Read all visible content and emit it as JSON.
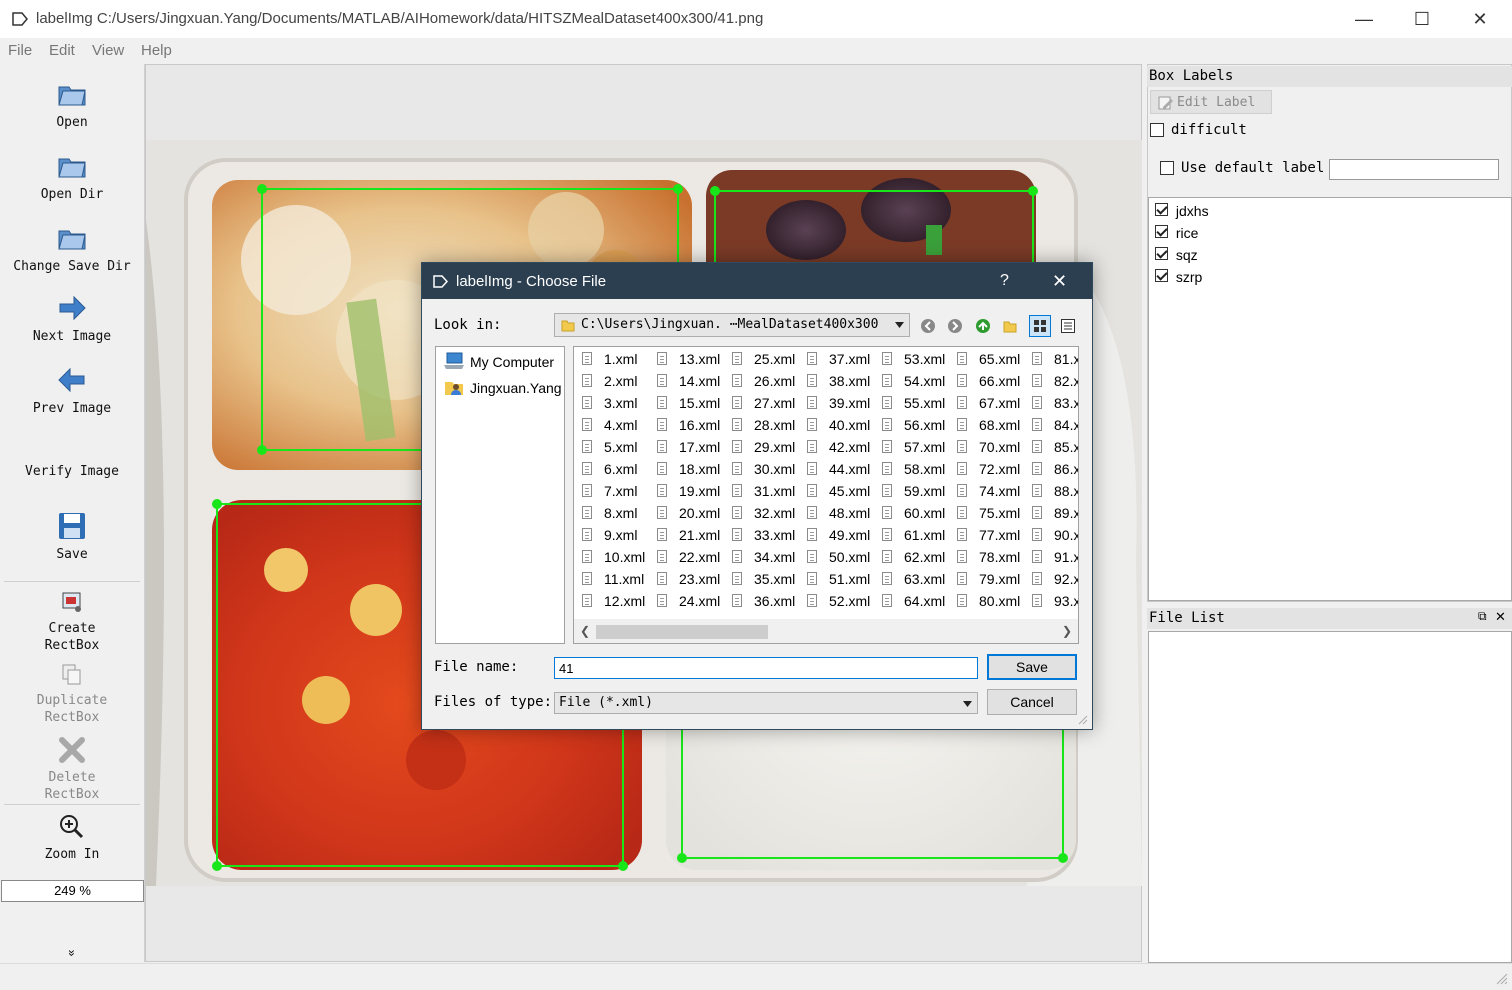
{
  "window": {
    "title": "labelImg C:/Users/Jingxuan.Yang/Documents/MATLAB/AIHomework/data/HITSZMealDataset400x300/41.png",
    "minimize_glyph": "—",
    "maximize_glyph": "☐",
    "close_glyph": "✕"
  },
  "menu": [
    "File",
    "Edit",
    "View",
    "Help"
  ],
  "toolbar": {
    "open": "Open",
    "open_dir": "Open Dir",
    "change_save_dir": "Change Save Dir",
    "next_image": "Next Image",
    "prev_image": "Prev Image",
    "verify_image": "Verify Image",
    "save": "Save",
    "create_rectbox_1": "Create",
    "create_rectbox_2": "RectBox",
    "duplicate_rectbox_1": "Duplicate",
    "duplicate_rectbox_2": "RectBox",
    "delete_rectbox_1": "Delete",
    "delete_rectbox_2": "RectBox",
    "zoom_in": "Zoom In",
    "zoom_value": "249 %",
    "more_glyph": "»"
  },
  "box_labels_panel": {
    "title": "Box Labels",
    "edit_label": "Edit Label",
    "difficult": "difficult",
    "use_default_label": "Use default label",
    "default_label_value": "",
    "labels": [
      {
        "name": "jdxhs",
        "checked": true
      },
      {
        "name": "rice",
        "checked": true
      },
      {
        "name": "sqz",
        "checked": true
      },
      {
        "name": "szrp",
        "checked": true
      }
    ]
  },
  "file_list_panel": {
    "title": "File List",
    "float_glyph": "⧉",
    "close_glyph": "✕"
  },
  "dialog": {
    "title": "labelImg - Choose File",
    "help_glyph": "?",
    "close_glyph": "✕",
    "look_in_label": "Look in:",
    "look_in_path": "C:\\Users\\Jingxuan.  ⋯MealDataset400x300",
    "places": [
      "My Computer",
      "Jingxuan.Yang"
    ],
    "files": [
      [
        "1.xml",
        "2.xml",
        "3.xml",
        "4.xml",
        "5.xml",
        "6.xml",
        "7.xml",
        "8.xml",
        "9.xml",
        "10.xml",
        "11.xml",
        "12.xml"
      ],
      [
        "13.xml",
        "14.xml",
        "15.xml",
        "16.xml",
        "17.xml",
        "18.xml",
        "19.xml",
        "20.xml",
        "21.xml",
        "22.xml",
        "23.xml",
        "24.xml"
      ],
      [
        "25.xml",
        "26.xml",
        "27.xml",
        "28.xml",
        "29.xml",
        "30.xml",
        "31.xml",
        "32.xml",
        "33.xml",
        "34.xml",
        "35.xml",
        "36.xml"
      ],
      [
        "37.xml",
        "38.xml",
        "39.xml",
        "40.xml",
        "42.xml",
        "44.xml",
        "45.xml",
        "48.xml",
        "49.xml",
        "50.xml",
        "51.xml",
        "52.xml"
      ],
      [
        "53.xml",
        "54.xml",
        "55.xml",
        "56.xml",
        "57.xml",
        "58.xml",
        "59.xml",
        "60.xml",
        "61.xml",
        "62.xml",
        "63.xml",
        "64.xml"
      ],
      [
        "65.xml",
        "66.xml",
        "67.xml",
        "68.xml",
        "70.xml",
        "72.xml",
        "74.xml",
        "75.xml",
        "77.xml",
        "78.xml",
        "79.xml",
        "80.xml"
      ],
      [
        "81.x",
        "82.x",
        "83.x",
        "84.x",
        "85.x",
        "86.x",
        "88.x",
        "89.x",
        "90.x",
        "91.x",
        "92.x",
        "93.x"
      ]
    ],
    "file_name_label": "File name:",
    "file_name_value": "41",
    "files_of_type_label": "Files of type:",
    "files_of_type_value": "File (*.xml)",
    "save_button": "Save",
    "cancel_button": "Cancel"
  },
  "colors": {
    "bbox": "#19e619",
    "dialog_title_bg": "#2b3f51",
    "accent": "#0078d7"
  }
}
